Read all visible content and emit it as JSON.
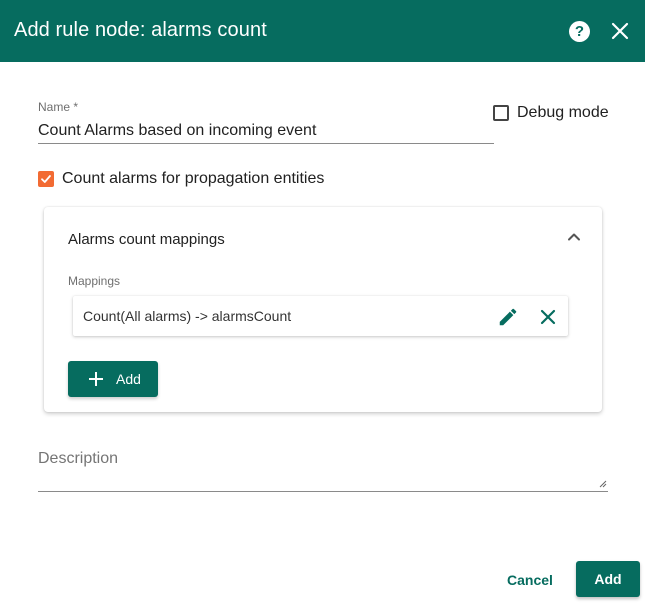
{
  "header": {
    "title": "Add rule node: alarms count",
    "help_icon": "help-icon",
    "help_glyph": "?",
    "close_icon": "close-icon"
  },
  "form": {
    "name_label": "Name *",
    "name_value": "Count Alarms based on incoming event",
    "debug_label": "Debug mode",
    "debug_checked": false,
    "propagation_label": "Count alarms for propagation entities",
    "propagation_checked": true,
    "description_placeholder": "Description",
    "description_value": ""
  },
  "panel": {
    "title": "Alarms count mappings",
    "expanded": true,
    "mappings_label": "Mappings",
    "mappings": [
      {
        "text": "Count(All alarms) -> alarmsCount"
      }
    ],
    "add_label": "Add"
  },
  "footer": {
    "cancel_label": "Cancel",
    "add_label": "Add"
  },
  "colors": {
    "primary": "#066c5f",
    "accent_checkbox": "#f26b33",
    "text": "#212121",
    "muted": "#6f6f6f"
  }
}
